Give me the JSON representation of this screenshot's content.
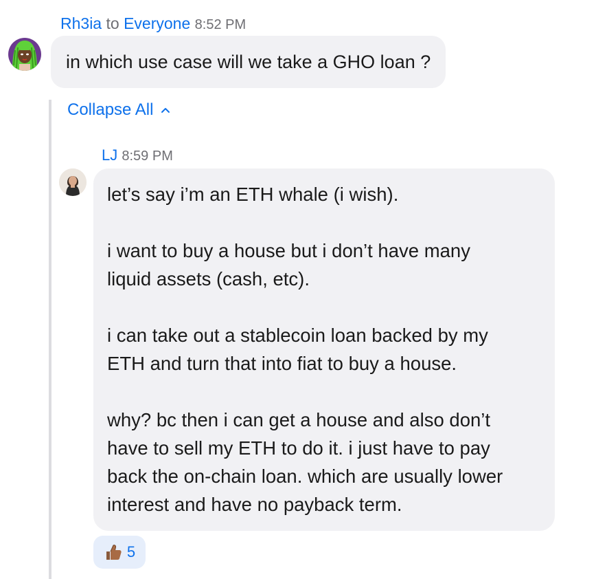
{
  "message1": {
    "sender": "Rh3ia",
    "to_word": "to",
    "recipient": "Everyone",
    "time": "8:52 PM",
    "text": "in which use case will we take a GHO loan ?",
    "avatar_icon": "user-avatar-green-hair"
  },
  "thread": {
    "collapse_label": "Collapse All",
    "collapse_icon": "chevron-up-icon"
  },
  "message2": {
    "sender": "LJ",
    "time": "8:59 PM",
    "avatar_icon": "user-avatar-photo",
    "paragraphs": [
      "let’s say i’m an ETH whale (i wish).",
      "i want to buy a house but i don’t have many\nliquid assets (cash, etc).",
      "i can take out a stablecoin loan backed by my\nETH and turn that into fiat to buy a house.",
      "why? bc then i can get a house and also don’t\nhave to sell my ETH to do it. i just have to pay\nback the on-chain loan. which are usually lower\ninterest and have no payback term."
    ],
    "reaction": {
      "icon": "thumbs-up-icon",
      "count": "5"
    }
  },
  "colors": {
    "link": "#0e71eb",
    "bubble": "#f1f1f4",
    "reaction_bg": "#e6eefb",
    "thread_line": "#dcdce0"
  }
}
